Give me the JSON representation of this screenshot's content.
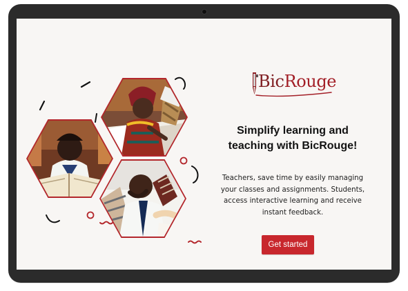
{
  "brand": {
    "name_left": "Bic",
    "name_right": "Rouge"
  },
  "hero": {
    "headline": "Simplify learning and\nteaching with BicRouge!",
    "description": "Teachers, save time by easily managing\nyour classes and assignments. Students,\naccess interactive learning and receive\ninstant feedback."
  },
  "actions": {
    "primary_label": "Get started"
  },
  "colors": {
    "accent": "#c8272d",
    "brand": "#7f1d21",
    "screen_background": "#f8f6f4",
    "device_frame": "#2b2b2b"
  },
  "icons": {
    "brand_mark": "red-pen-icon",
    "decorative_shapes": "doodle-icons"
  },
  "collage": {
    "images": [
      "woman-grading-papers-photo",
      "student-reading-photo",
      "teacher-with-paper-stacks-photo"
    ]
  }
}
